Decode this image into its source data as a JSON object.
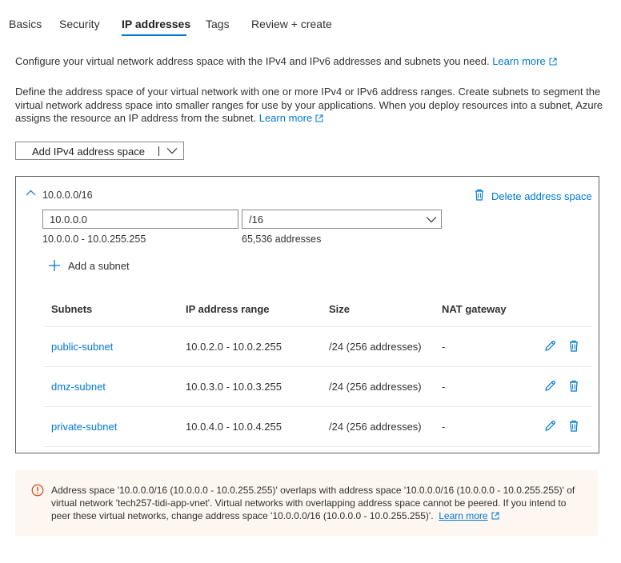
{
  "tabs": [
    {
      "label": "Basics"
    },
    {
      "label": "Security"
    },
    {
      "label": "IP addresses"
    },
    {
      "label": "Tags"
    },
    {
      "label": "Review + create"
    }
  ],
  "active_tab": "IP addresses",
  "intro": {
    "line1": "Configure your virtual network address space with the IPv4 and IPv6 addresses and subnets you need.",
    "line1_link": "Learn more",
    "line2": "Define the address space of your virtual network with one or more IPv4 or IPv6 address ranges. Create subnets to segment the virtual network address space into smaller ranges for use by your applications. When you deploy resources into a subnet, Azure assigns the resource an IP address from the subnet.",
    "line2_link": "Learn more"
  },
  "add_space_button": "Add IPv4 address space",
  "address_space": {
    "title": "10.0.0.0/16",
    "delete_label": "Delete address space",
    "address_value": "10.0.0.0",
    "prefix_value": "/16",
    "range": "10.0.0.0 - 10.0.255.255",
    "count": "65,536 addresses",
    "add_subnet_label": "Add a subnet"
  },
  "subnets_table": {
    "headers": {
      "name": "Subnets",
      "range": "IP address range",
      "size": "Size",
      "nat": "NAT gateway"
    },
    "rows": [
      {
        "name": "public-subnet",
        "range": "10.0.2.0 - 10.0.2.255",
        "size": "/24 (256 addresses)",
        "nat": "-"
      },
      {
        "name": "dmz-subnet",
        "range": "10.0.3.0 - 10.0.3.255",
        "size": "/24 (256 addresses)",
        "nat": "-"
      },
      {
        "name": "private-subnet",
        "range": "10.0.4.0 - 10.0.4.255",
        "size": "/24 (256 addresses)",
        "nat": "-"
      }
    ]
  },
  "warning": {
    "text": "Address space '10.0.0.0/16 (10.0.0.0 - 10.0.255.255)' overlaps with address space '10.0.0.0/16 (10.0.0.0 - 10.0.255.255)' of virtual network 'tech257-tidi-app-vnet'. Virtual networks with overlapping address space cannot be peered. If you intend to peer these virtual networks, change address space '10.0.0.0/16 (10.0.0.0 - 10.0.255.255)'.",
    "link": "Learn more"
  },
  "colors": {
    "accent": "#0078d4",
    "warning_bg": "#fdf6f1",
    "warning_icon": "#d83b01"
  }
}
